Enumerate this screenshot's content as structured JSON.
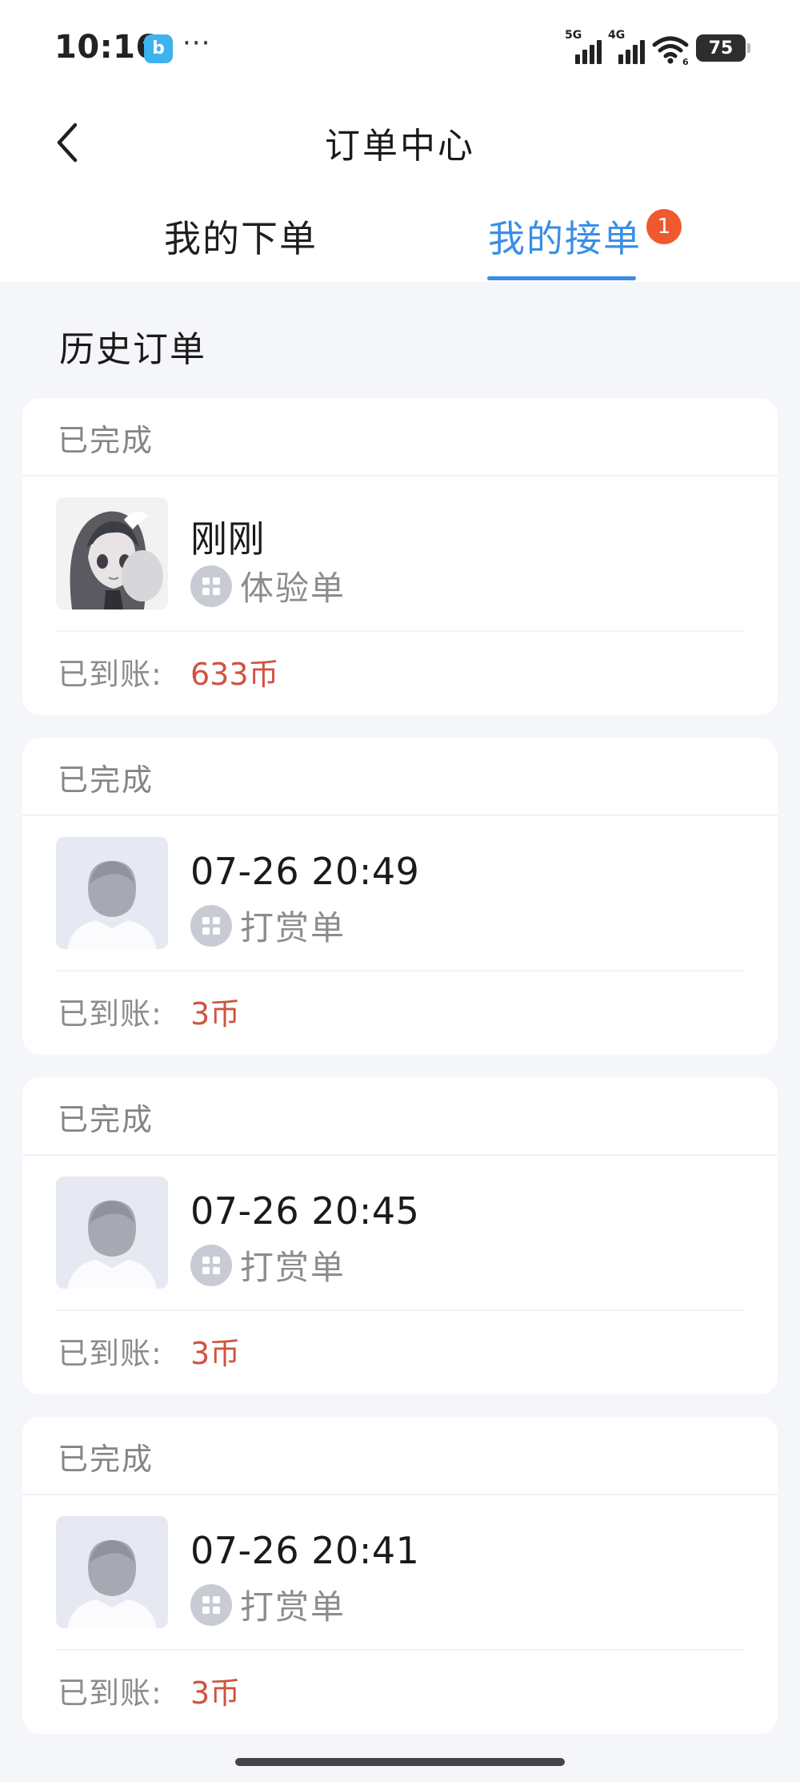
{
  "status_bar": {
    "time": "10:16",
    "app_icon": "b",
    "more": "···",
    "network1": "5G",
    "network2": "4G",
    "wifi_badge": "6",
    "battery": "75"
  },
  "header": {
    "title": "订单中心",
    "back_icon": "chevron-left-icon"
  },
  "tabs": [
    {
      "label": "我的下单",
      "active": false
    },
    {
      "label": "我的接单",
      "active": true,
      "badge": "1"
    }
  ],
  "section_title": "历史订单",
  "colors": {
    "accent": "#3a8ee6",
    "badge": "#ee5a2e",
    "amount": "#d0533f",
    "background": "#f4f6f9"
  },
  "orders": [
    {
      "status": "已完成",
      "name": "刚刚",
      "type": "体验单",
      "amount_label": "已到账:",
      "amount": "633币",
      "avatar": "anime-avatar"
    },
    {
      "status": "已完成",
      "name": "07-26 20:49",
      "type": "打赏单",
      "amount_label": "已到账:",
      "amount": "3币",
      "avatar": "default-avatar"
    },
    {
      "status": "已完成",
      "name": "07-26 20:45",
      "type": "打赏单",
      "amount_label": "已到账:",
      "amount": "3币",
      "avatar": "default-avatar"
    },
    {
      "status": "已完成",
      "name": "07-26 20:41",
      "type": "打赏单",
      "amount_label": "已到账:",
      "amount": "3币",
      "avatar": "default-avatar"
    }
  ]
}
